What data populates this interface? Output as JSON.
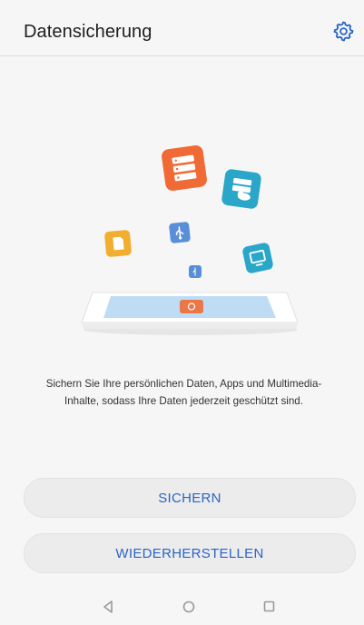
{
  "app": {
    "title": "Datensicherung"
  },
  "header": {
    "settings_icon": "gear-icon"
  },
  "illustration": {
    "icons": [
      "server-icon",
      "cloud-storage-icon",
      "sd-card-icon",
      "usb-icon",
      "usb-small-icon",
      "monitor-icon",
      "phone-icon"
    ],
    "colors": {
      "orange": "#f06a35",
      "teal": "#2aa6c9",
      "yellow": "#f2ae2e",
      "blue": "#5a8fd8",
      "phone_screen": "#bfdcf5"
    }
  },
  "description": {
    "line1": "Sichern Sie Ihre persönlichen Daten, Apps und Multimedia-",
    "line2": "Inhalte, sodass Ihre Daten jederzeit geschützt sind."
  },
  "actions": {
    "backup_label": "SICHERN",
    "restore_label": "WIEDERHERSTELLEN"
  },
  "navigation": {
    "back": "back-icon",
    "home": "home-icon",
    "recent": "recent-apps-icon"
  },
  "theme": {
    "accent": "#2a64c4",
    "background": "#f6f6f6",
    "button_bg": "#ececec"
  }
}
